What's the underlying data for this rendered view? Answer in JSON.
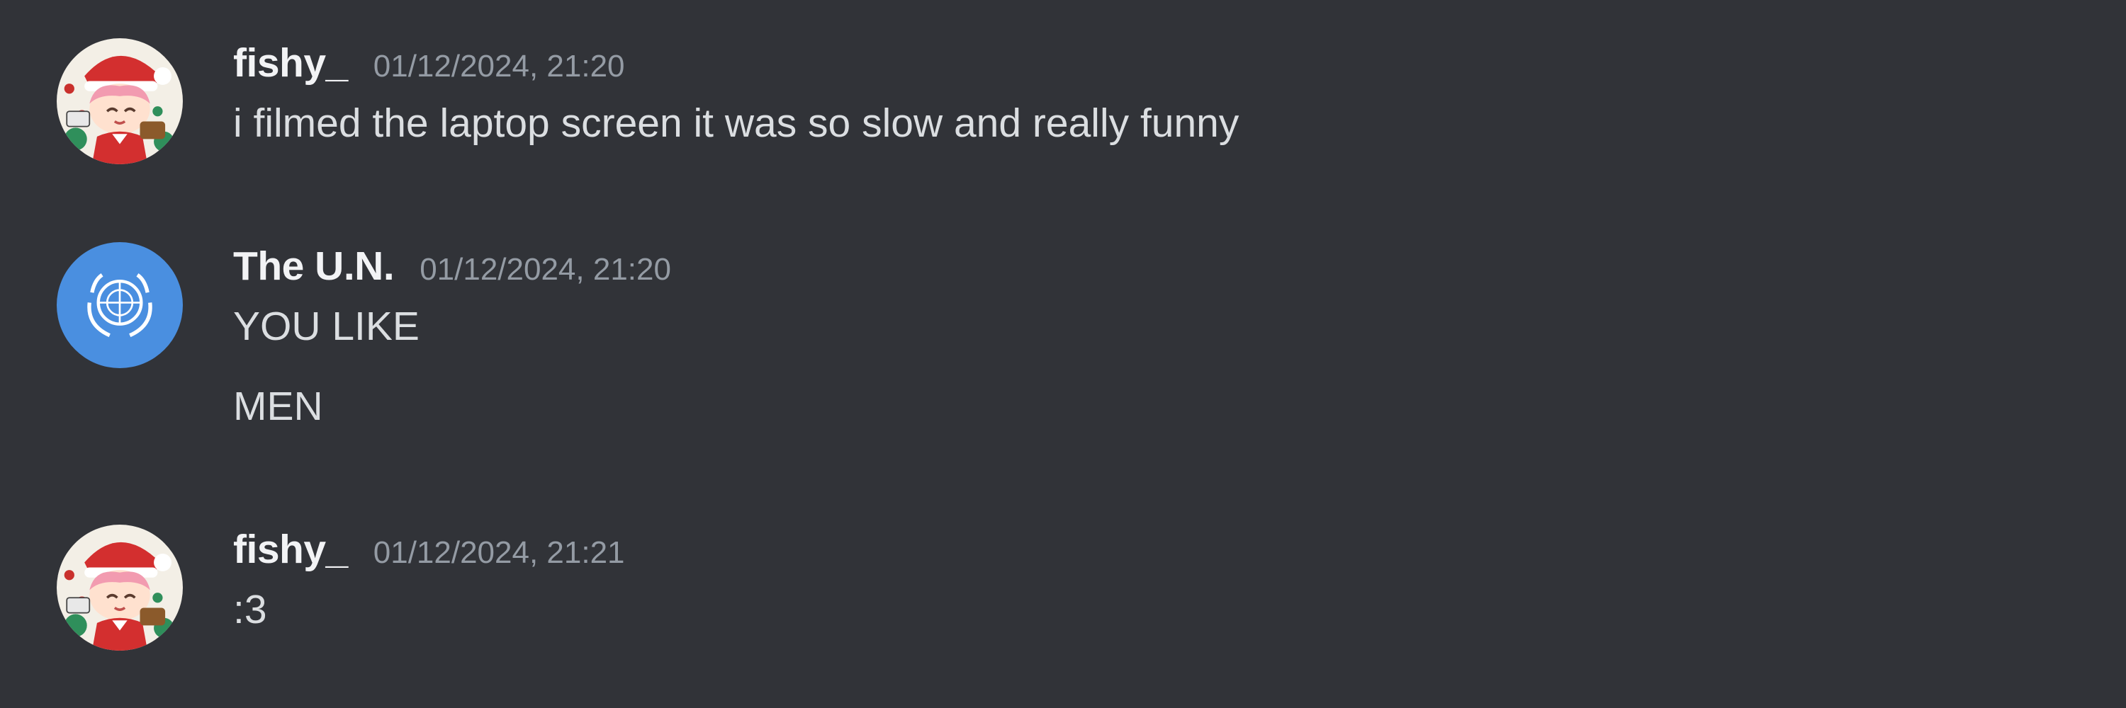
{
  "messages": [
    {
      "author": "fishy_",
      "timestamp": "01/12/2024, 21:20",
      "avatar_icon": "anime-christmas-avatar-icon",
      "lines": [
        "i filmed the laptop screen it was so slow and really funny"
      ]
    },
    {
      "author": "The U.N.",
      "timestamp": "01/12/2024, 21:20",
      "avatar_icon": "un-emblem-avatar-icon",
      "avatar_color": "#4a8fe0",
      "lines": [
        "YOU LIKE",
        "MEN"
      ]
    },
    {
      "author": "fishy_",
      "timestamp": "01/12/2024, 21:21",
      "avatar_icon": "anime-christmas-avatar-icon",
      "lines": [
        ":3"
      ]
    }
  ],
  "colors": {
    "background": "#313338",
    "username": "#f2f3f5",
    "timestamp": "#949ba4",
    "text": "#dbdee1"
  }
}
